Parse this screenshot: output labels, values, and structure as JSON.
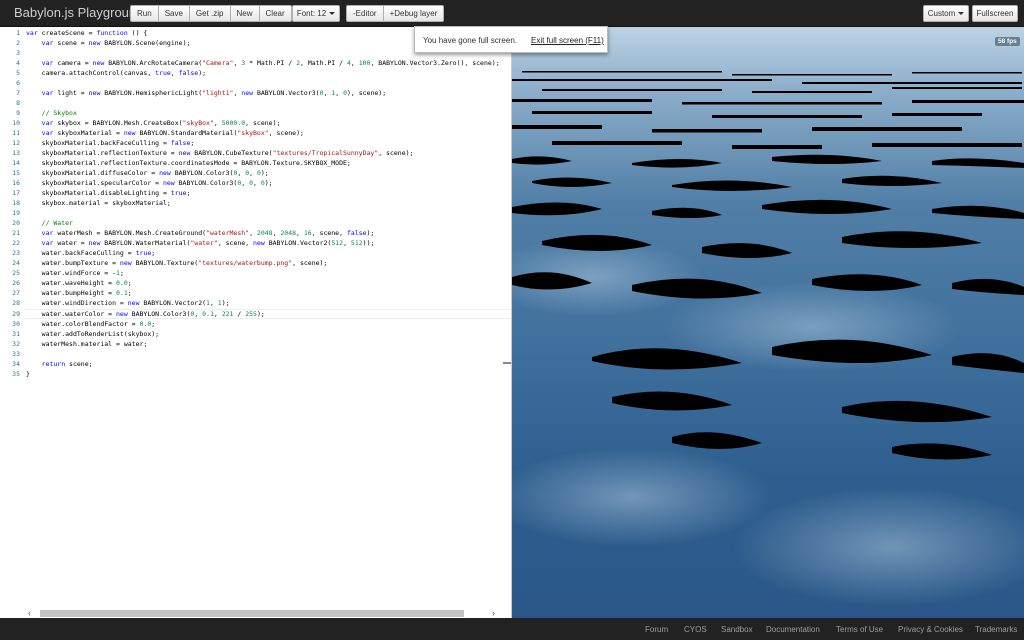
{
  "navbar": {
    "brand": "Babylon.js Playground",
    "buttons": {
      "run": "Run",
      "save": "Save",
      "get_zip": "Get .zip",
      "new": "New",
      "clear": "Clear",
      "font": "Font: 12",
      "editor": "-Editor",
      "debug": "+Debug layer",
      "custom": "Custom",
      "fullscreen": "Fullscreen"
    }
  },
  "notice": {
    "text": "You have gone full screen.",
    "exit": "Exit full screen (F11)"
  },
  "render": {
    "fps": "58 fps"
  },
  "editor": {
    "line_numbers": [
      "1",
      "2",
      "3",
      "4",
      "5",
      "6",
      "7",
      "8",
      "9",
      "10",
      "11",
      "12",
      "13",
      "14",
      "15",
      "16",
      "17",
      "18",
      "19",
      "20",
      "21",
      "22",
      "23",
      "24",
      "25",
      "26",
      "27",
      "28",
      "29",
      "30",
      "31",
      "32",
      "33",
      "34",
      "35"
    ]
  },
  "footer": {
    "links": [
      "Forum",
      "CYOS",
      "Sandbox",
      "Documentation",
      "Terms of Use",
      "Privacy & Cookies",
      "Trademarks"
    ]
  }
}
